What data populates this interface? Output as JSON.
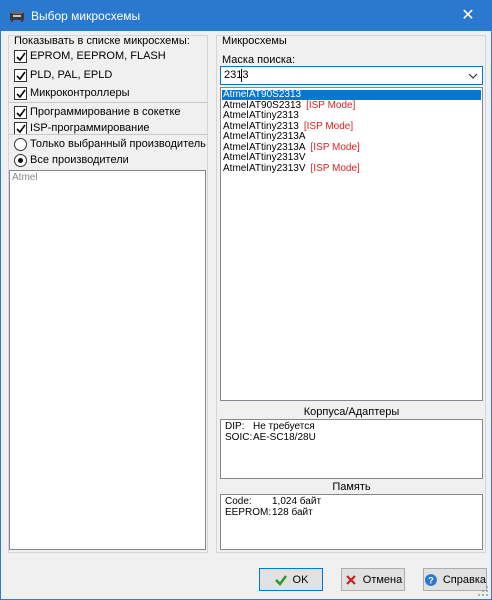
{
  "window": {
    "title": "Выбор микросхемы",
    "close_glyph": "✕"
  },
  "left": {
    "show_label": "Показывать в списке микросхемы:",
    "checks": [
      {
        "label": "EPROM, EEPROM, FLASH",
        "checked": true
      },
      {
        "label": "PLD, PAL, EPLD",
        "checked": true
      },
      {
        "label": "Микроконтроллеры",
        "checked": true
      }
    ],
    "options": [
      {
        "label": "Программирование в сокетке",
        "checked": true
      },
      {
        "label": "ISP-программирование",
        "checked": true
      }
    ],
    "radios": [
      {
        "label": "Только выбранный производитель",
        "selected": false
      },
      {
        "label": "Все производители",
        "selected": true
      }
    ],
    "vendors": [
      "Atmel"
    ]
  },
  "right": {
    "chips_label": "Микросхемы",
    "mask_label": "Маска поиска:",
    "mask_value": "2313",
    "chips": [
      {
        "vendor": "Atmel",
        "name": "AT90S2313",
        "isp": "",
        "selected": true
      },
      {
        "vendor": "Atmel",
        "name": "AT90S2313",
        "isp": "[ISP Mode]",
        "selected": false
      },
      {
        "vendor": "Atmel",
        "name": "ATtiny2313",
        "isp": "",
        "selected": false
      },
      {
        "vendor": "Atmel",
        "name": "ATtiny2313",
        "isp": "[ISP Mode]",
        "selected": false
      },
      {
        "vendor": "Atmel",
        "name": "ATtiny2313A",
        "isp": "",
        "selected": false
      },
      {
        "vendor": "Atmel",
        "name": "ATtiny2313A",
        "isp": "[ISP Mode]",
        "selected": false
      },
      {
        "vendor": "Atmel",
        "name": "ATtiny2313V",
        "isp": "",
        "selected": false
      },
      {
        "vendor": "Atmel",
        "name": "ATtiny2313V",
        "isp": "[ISP Mode]",
        "selected": false
      }
    ],
    "packages_title": "Корпуса/Адаптеры",
    "packages": [
      {
        "key": "DIP:",
        "value": "Не требуется"
      },
      {
        "key": "SOIC:",
        "value": "AE-SC18/28U"
      }
    ],
    "memory_title": "Память",
    "memory": [
      {
        "key": "Code:",
        "value": "1,024 байт"
      },
      {
        "key": "EEPROM:",
        "value": "128 байт"
      }
    ]
  },
  "buttons": {
    "ok": "OK",
    "cancel": "Отмена",
    "help": "Справка"
  },
  "colors": {
    "title_bar": "#2b79cf",
    "selection": "#0078d7",
    "isp_text": "#e02020"
  }
}
